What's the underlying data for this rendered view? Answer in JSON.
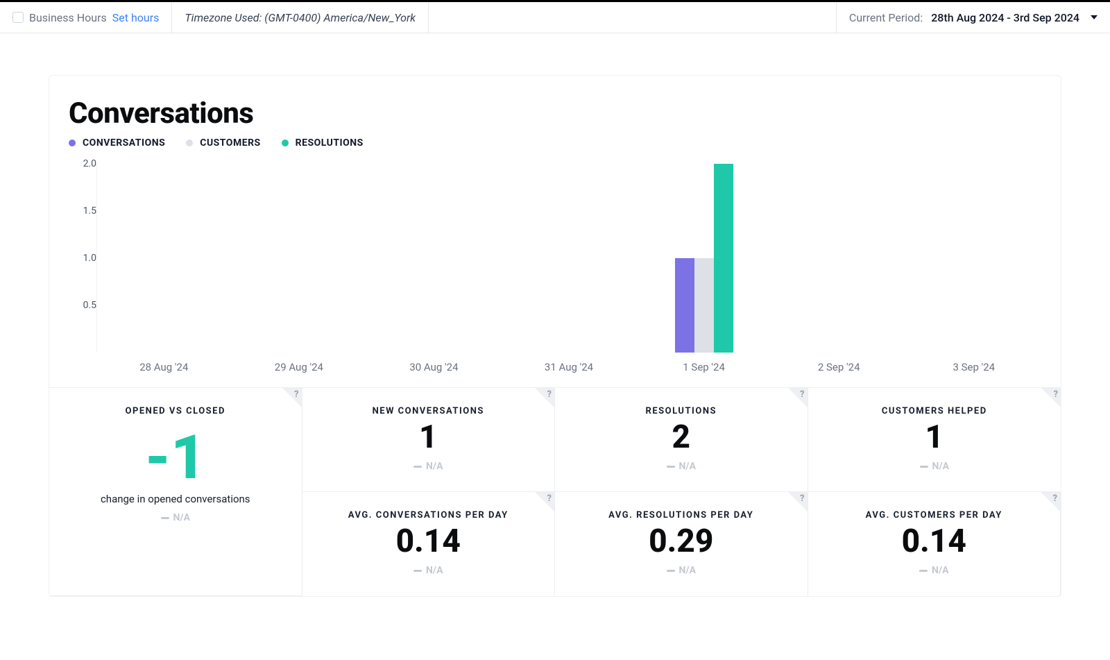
{
  "topbar": {
    "business_hours_label": "Business Hours",
    "set_hours_link": "Set hours",
    "timezone": "Timezone Used: (GMT-0400) America/New_York",
    "current_period_label": "Current Period:",
    "current_period_value": "28th Aug 2024 - 3rd Sep 2024"
  },
  "page": {
    "title": "Conversations"
  },
  "legend": [
    {
      "label": "CONVERSATIONS",
      "color": "#7c72e6"
    },
    {
      "label": "CUSTOMERS",
      "color": "#dde0e6"
    },
    {
      "label": "RESOLUTIONS",
      "color": "#1fc8a8"
    }
  ],
  "chart_data": {
    "type": "bar",
    "categories": [
      "28 Aug '24",
      "29 Aug '24",
      "30 Aug '24",
      "31 Aug '24",
      "1 Sep '24",
      "2 Sep '24",
      "3 Sep '24"
    ],
    "series": [
      {
        "name": "CONVERSATIONS",
        "color": "#7c72e6",
        "values": [
          0,
          0,
          0,
          0,
          1,
          0,
          0
        ]
      },
      {
        "name": "CUSTOMERS",
        "color": "#dde0e6",
        "values": [
          0,
          0,
          0,
          0,
          1,
          0,
          0
        ]
      },
      {
        "name": "RESOLUTIONS",
        "color": "#1fc8a8",
        "values": [
          0,
          0,
          0,
          0,
          2,
          0,
          0
        ]
      }
    ],
    "ylim": [
      0,
      2
    ],
    "yticks": [
      2.0,
      1.5,
      1.0,
      0.5
    ],
    "xlabel": "",
    "ylabel": "",
    "title": "Conversations"
  },
  "kpis": {
    "opened_vs_closed": {
      "label": "OPENED VS CLOSED",
      "value": "-1",
      "sub": "change in opened conversations",
      "na": "N/A"
    },
    "new_conversations": {
      "label": "NEW CONVERSATIONS",
      "value": "1",
      "na": "N/A"
    },
    "resolutions": {
      "label": "RESOLUTIONS",
      "value": "2",
      "na": "N/A"
    },
    "customers_helped": {
      "label": "CUSTOMERS HELPED",
      "value": "1",
      "na": "N/A"
    },
    "avg_conv_per_day": {
      "label": "AVG. CONVERSATIONS PER DAY",
      "value": "0.14",
      "na": "N/A"
    },
    "avg_res_per_day": {
      "label": "AVG. RESOLUTIONS PER DAY",
      "value": "0.29",
      "na": "N/A"
    },
    "avg_cust_per_day": {
      "label": "AVG. CUSTOMERS PER DAY",
      "value": "0.14",
      "na": "N/A"
    }
  },
  "colors": {
    "accent_green": "#1fc8a8",
    "accent_purple": "#7c72e6",
    "muted_grey": "#dde0e6"
  }
}
